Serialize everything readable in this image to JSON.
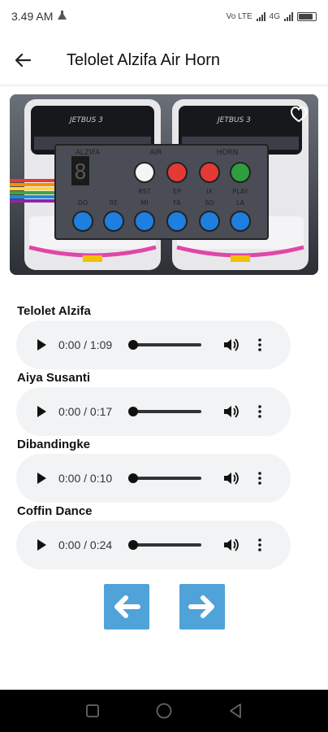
{
  "status_bar": {
    "time": "3.49 AM",
    "network": "Vo LTE",
    "signal_2": "4G"
  },
  "app_bar": {
    "title": "Telolet Alzifa Air Horn"
  },
  "hero": {
    "image": "bus-horn-control-panel",
    "panel_top_labels": [
      "ALZIFA",
      "AIR",
      "HORN"
    ],
    "panel_row1_labels": [
      "RST",
      "EP",
      "IX",
      "PLAY"
    ],
    "panel_row2_labels": [
      "DO",
      "RE",
      "MI",
      "FA",
      "SO",
      "LA"
    ],
    "bus_brand": "JETBUS 3",
    "colors": {
      "white": "#f5f5f5",
      "red": "#e53935",
      "green": "#2e9e3e",
      "blue": "#1e7fe0",
      "bus_pink": "#e046a8"
    }
  },
  "sounds": [
    {
      "title": "Telolet Alzifa",
      "time": "0:00 / 1:09"
    },
    {
      "title": "Aiya Susanti",
      "time": "0:00 / 0:17"
    },
    {
      "title": "Dibandingke",
      "time": "0:00 / 0:10"
    },
    {
      "title": "Coffin Dance",
      "time": "0:00 / 0:24"
    }
  ],
  "nav": {
    "prev_icon": "arrow-left-icon",
    "next_icon": "arrow-right-icon",
    "accent": "#4fa3d8"
  },
  "system_nav": {
    "icons": [
      "recents-icon",
      "home-icon",
      "back-icon"
    ]
  }
}
